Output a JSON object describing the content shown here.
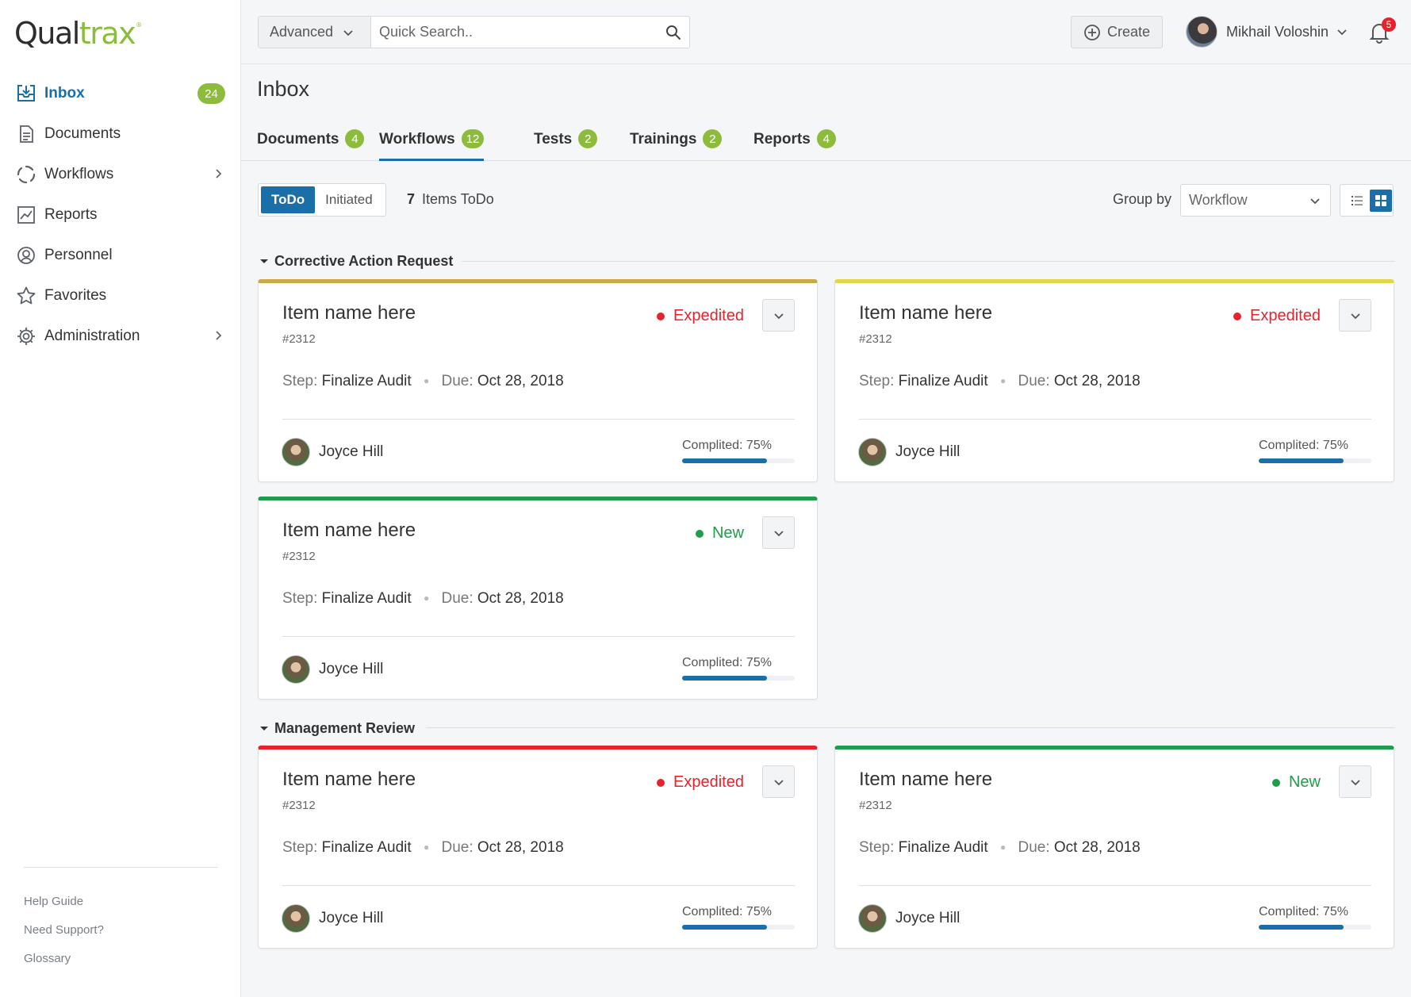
{
  "logo": {
    "part1": "Qual",
    "part2": "trax",
    "mark": "®"
  },
  "sidebar": {
    "items": [
      {
        "label": "Inbox",
        "icon": "inbox-icon",
        "count": "24",
        "active": true
      },
      {
        "label": "Documents",
        "icon": "document-icon"
      },
      {
        "label": "Workflows",
        "icon": "workflow-icon",
        "has_submenu": true
      },
      {
        "label": "Reports",
        "icon": "chart-icon"
      },
      {
        "label": "Personnel",
        "icon": "user-circle-icon"
      },
      {
        "label": "Favorites",
        "icon": "star-icon"
      },
      {
        "label": "Administration",
        "icon": "gear-icon",
        "has_submenu": true
      }
    ],
    "help_links": [
      "Help Guide",
      "Need Support?",
      "Glossary"
    ]
  },
  "topbar": {
    "advanced_label": "Advanced",
    "search_placeholder": "Quick Search..",
    "create_label": "Create",
    "user_name": "Mikhail Voloshin",
    "notification_count": "5"
  },
  "page": {
    "title": "Inbox",
    "tabs": [
      {
        "label": "Documents",
        "count": "4"
      },
      {
        "label": "Workflows",
        "count": "12",
        "active": true
      },
      {
        "label": "Tests",
        "count": "2"
      },
      {
        "label": "Trainings",
        "count": "2"
      },
      {
        "label": "Reports",
        "count": "4"
      }
    ],
    "filter": {
      "todo": "ToDo",
      "initiated": "Initiated",
      "selected": "ToDo"
    },
    "items_count": "7",
    "items_label": "Items ToDo",
    "group_by_label": "Group by",
    "group_by_value": "Workflow",
    "view_mode": "grid"
  },
  "colors": {
    "accent": "#1b6fa8",
    "badge_green": "#8dbb3c",
    "expedited": "#e8222b",
    "new": "#1e9e4a"
  },
  "groups": [
    {
      "name": "Corrective Action Request",
      "cards": [
        {
          "title": "Item name here",
          "number": "#2312",
          "status": "Expedited",
          "status_color": "#e8222b",
          "bar_color": "#c9a94a",
          "step_label": "Step:",
          "step": "Finalize Audit",
          "due_label": "Due:",
          "due": "Oct 28, 2018",
          "assignee": "Joyce Hill",
          "progress_label": "Complited: 75%",
          "progress": 0.75
        },
        {
          "title": "Item name here",
          "number": "#2312",
          "status": "Expedited",
          "status_color": "#e8222b",
          "bar_color": "#e0d84a",
          "step_label": "Step:",
          "step": "Finalize Audit",
          "due_label": "Due:",
          "due": "Oct 28, 2018",
          "assignee": "Joyce Hill",
          "progress_label": "Complited: 75%",
          "progress": 0.75
        },
        {
          "title": "Item name here",
          "number": "#2312",
          "status": "New",
          "status_color": "#1e9e4a",
          "bar_color": "#1e9e4a",
          "step_label": "Step:",
          "step": "Finalize Audit",
          "due_label": "Due:",
          "due": "Oct 28, 2018",
          "assignee": "Joyce Hill",
          "progress_label": "Complited: 75%",
          "progress": 0.75
        }
      ]
    },
    {
      "name": "Management Review",
      "cards": [
        {
          "title": "Item name here",
          "number": "#2312",
          "status": "Expedited",
          "status_color": "#e8222b",
          "bar_color": "#e8222b",
          "step_label": "Step:",
          "step": "Finalize Audit",
          "due_label": "Due:",
          "due": "Oct 28, 2018",
          "assignee": "Joyce Hill",
          "progress_label": "Complited: 75%",
          "progress": 0.75
        },
        {
          "title": "Item name here",
          "number": "#2312",
          "status": "New",
          "status_color": "#1e9e4a",
          "bar_color": "#1e9e4a",
          "step_label": "Step:",
          "step": "Finalize Audit",
          "due_label": "Due:",
          "due": "Oct 28, 2018",
          "assignee": "Joyce Hill",
          "progress_label": "Complited: 75%",
          "progress": 0.75
        }
      ]
    }
  ]
}
